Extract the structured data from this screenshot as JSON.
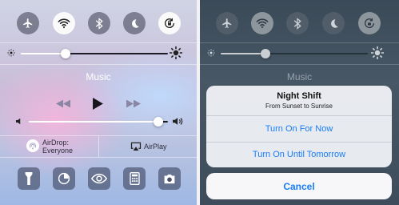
{
  "left": {
    "toggles": [
      {
        "name": "airplane-mode-toggle",
        "icon": "airplane-icon",
        "state": "off"
      },
      {
        "name": "wifi-toggle",
        "icon": "wifi-icon",
        "state": "on"
      },
      {
        "name": "bluetooth-toggle",
        "icon": "bluetooth-icon",
        "state": "off"
      },
      {
        "name": "do-not-disturb-toggle",
        "icon": "moon-icon",
        "state": "off"
      },
      {
        "name": "rotation-lock-toggle",
        "icon": "rotation-lock-icon",
        "state": "on"
      }
    ],
    "brightness_level": 0.27,
    "music_title": "Music",
    "volume_level": 0.93,
    "airdrop": {
      "label": "AirDrop:",
      "value": "Everyone"
    },
    "airplay_label": "AirPlay",
    "shortcuts": [
      "flashlight-icon",
      "timer-icon",
      "night-shift-eye-icon",
      "calculator-icon",
      "camera-icon"
    ]
  },
  "right": {
    "music_title": "Music",
    "sheet": {
      "title": "Night Shift",
      "subtitle": "From Sunset to Sunrise",
      "option_1": "Turn On For Now",
      "option_2": "Turn On Until Tomorrow",
      "cancel": "Cancel"
    }
  },
  "colors": {
    "accent_blue": "#1a7df5",
    "toggle_on": "#fafafa"
  }
}
